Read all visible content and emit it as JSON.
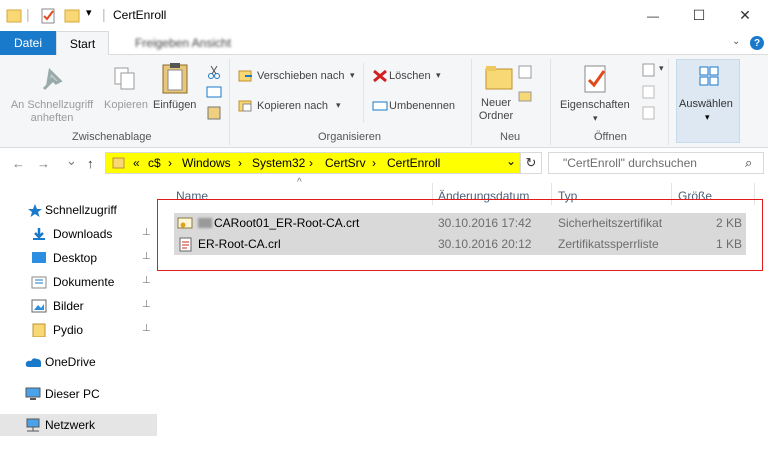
{
  "window": {
    "title": "CertEnroll",
    "minimize_glyph": "—",
    "maximize_glyph": "☐",
    "close_glyph": "✕"
  },
  "quick_access": {
    "dropdown_glyph": "▾"
  },
  "ribbon_tabs": {
    "file": "Datei",
    "start": "Start",
    "share_view": "Freigeben   Ansicht",
    "help": "?"
  },
  "ribbon": {
    "clipboard": {
      "pin_quick_access": "An Schnellzugriff anheften",
      "copy": "Kopieren",
      "paste": "Einfügen",
      "group_label": "Zwischenablage"
    },
    "organize": {
      "move_to": "Verschieben nach",
      "copy_to": "Kopieren nach",
      "delete": "Löschen",
      "rename": "Umbenennen",
      "group_label": "Organisieren"
    },
    "new": {
      "new_folder": "Neuer Ordner",
      "group_label": "Neu"
    },
    "open": {
      "properties": "Eigenschaften",
      "group_label": "Öffnen"
    },
    "select": {
      "select": "Auswählen"
    }
  },
  "address": {
    "back": "←",
    "forward": "→",
    "recent": "⌄",
    "up": "↑",
    "overflow": "«",
    "crumbs": [
      "c$",
      "Windows",
      "System32",
      "CertSrv",
      "CertEnroll"
    ],
    "separator": "›",
    "dropdown": "⌄",
    "refresh": "↻",
    "search_placeholder": "\"CertEnroll\" durchsuchen",
    "search_icon": "⌕"
  },
  "nav": {
    "items": [
      {
        "label": "Schnellzugriff",
        "icon": "star-icon"
      },
      {
        "label": "Downloads",
        "icon": "download-icon",
        "pinned": true
      },
      {
        "label": "Desktop",
        "icon": "desktop-icon",
        "pinned": true
      },
      {
        "label": "Dokumente",
        "icon": "documents-icon",
        "pinned": true
      },
      {
        "label": "Bilder",
        "icon": "pictures-icon",
        "pinned": true
      },
      {
        "label": "Pydio",
        "icon": "folder-icon",
        "pinned": true
      },
      {
        "label": "OneDrive",
        "icon": "cloud-icon"
      },
      {
        "label": "Dieser PC",
        "icon": "computer-icon"
      },
      {
        "label": "Netzwerk",
        "icon": "network-icon",
        "selected": true
      }
    ],
    "pin_glyph": "📌"
  },
  "columns": {
    "name": "Name",
    "date": "Änderungsdatum",
    "type": "Typ",
    "size": "Größe",
    "sort_glyph": "^"
  },
  "files": [
    {
      "name": "CARoot01_ER-Root-CA.crt",
      "date": "30.10.2016 17:42",
      "type": "Sicherheitszertifikat",
      "size": "2 KB",
      "icon": "certificate-icon"
    },
    {
      "name": "ER-Root-CA.crl",
      "date": "30.10.2016 20:12",
      "type": "Zertifikatssperrliste",
      "size": "1 KB",
      "icon": "revocation-list-icon"
    }
  ],
  "colors": {
    "accent": "#1979ca",
    "address_highlight": "#ffff00",
    "annotation": "#e21b1b"
  }
}
